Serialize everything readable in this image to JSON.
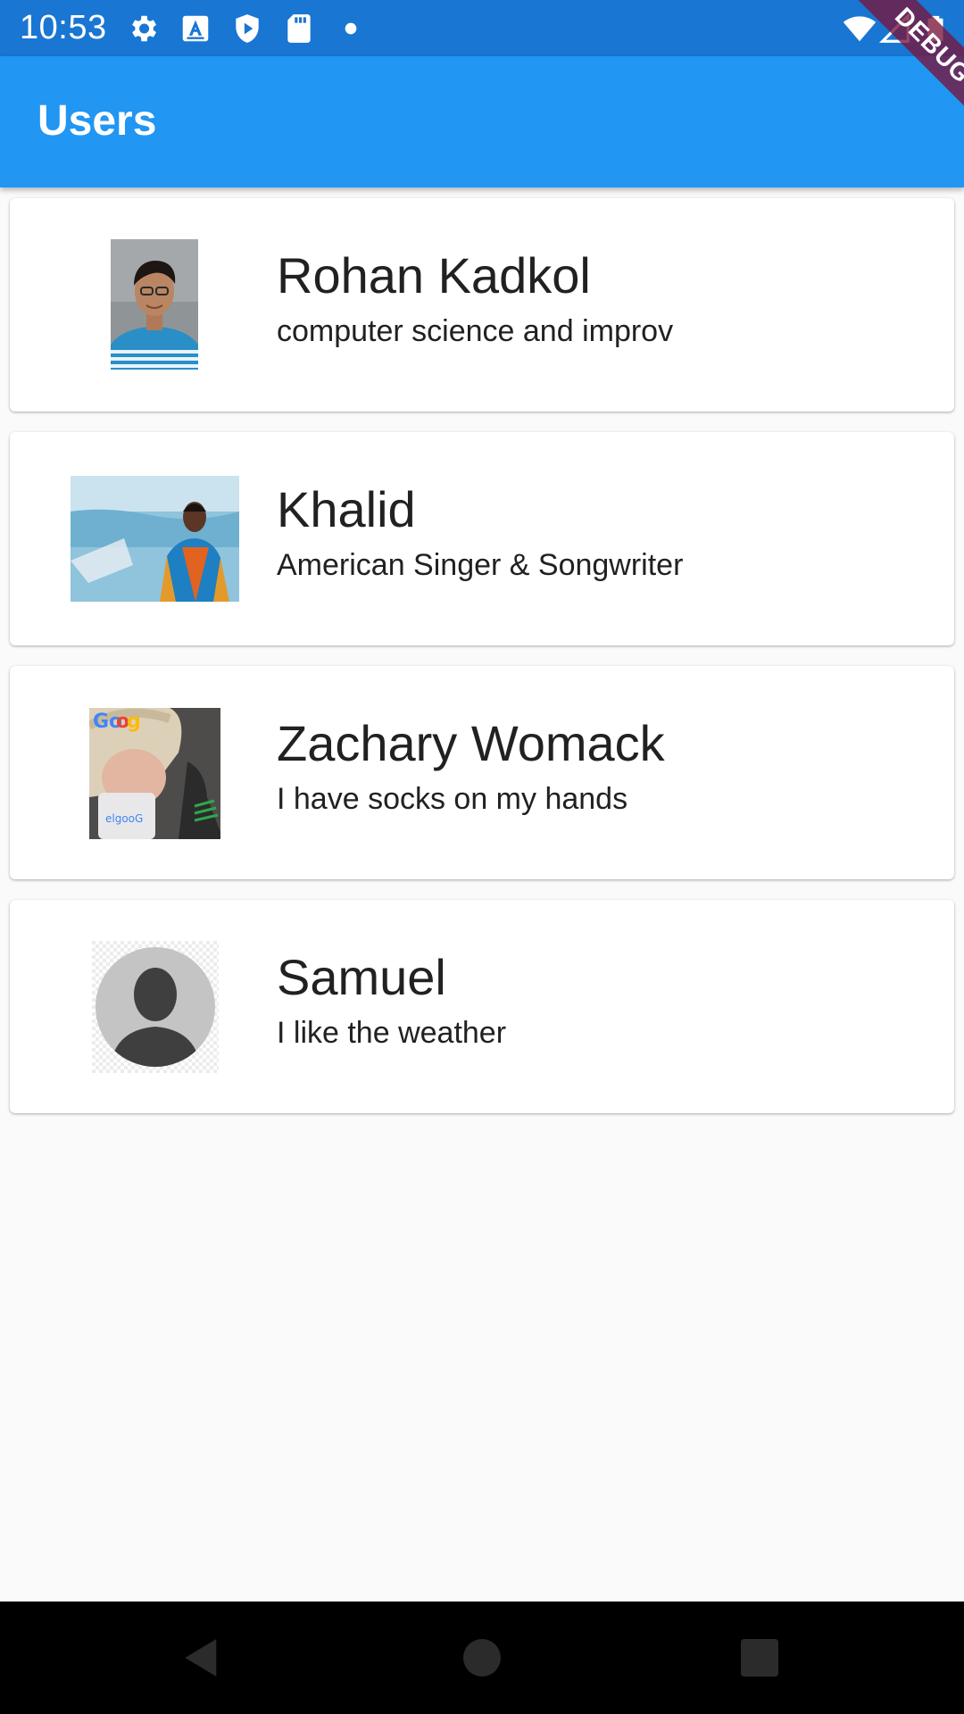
{
  "status_bar": {
    "time": "10:53",
    "left_icons": [
      "gear-icon",
      "a-badge-icon",
      "shield-play-icon",
      "sd-card-icon",
      "dot-icon"
    ],
    "right_icons": [
      "wifi-icon",
      "signal-icon",
      "battery-icon"
    ]
  },
  "app_bar": {
    "title": "Users"
  },
  "debug_banner": {
    "label": "DEBUG"
  },
  "users": [
    {
      "name": "Rohan Kadkol",
      "description": "computer science and improv"
    },
    {
      "name": "Khalid",
      "description": "American Singer & Songwriter"
    },
    {
      "name": "Zachary Womack",
      "description": "I have socks on my hands"
    },
    {
      "name": "Samuel",
      "description": "I like the weather"
    }
  ],
  "nav_bar": {
    "buttons": [
      "back-icon",
      "home-icon",
      "recents-icon"
    ]
  },
  "colors": {
    "status_bar": "#1976d2",
    "app_bar": "#2196f3",
    "background": "#fafafa",
    "card": "#ffffff",
    "text": "#212121",
    "nav_bar": "#000000"
  }
}
